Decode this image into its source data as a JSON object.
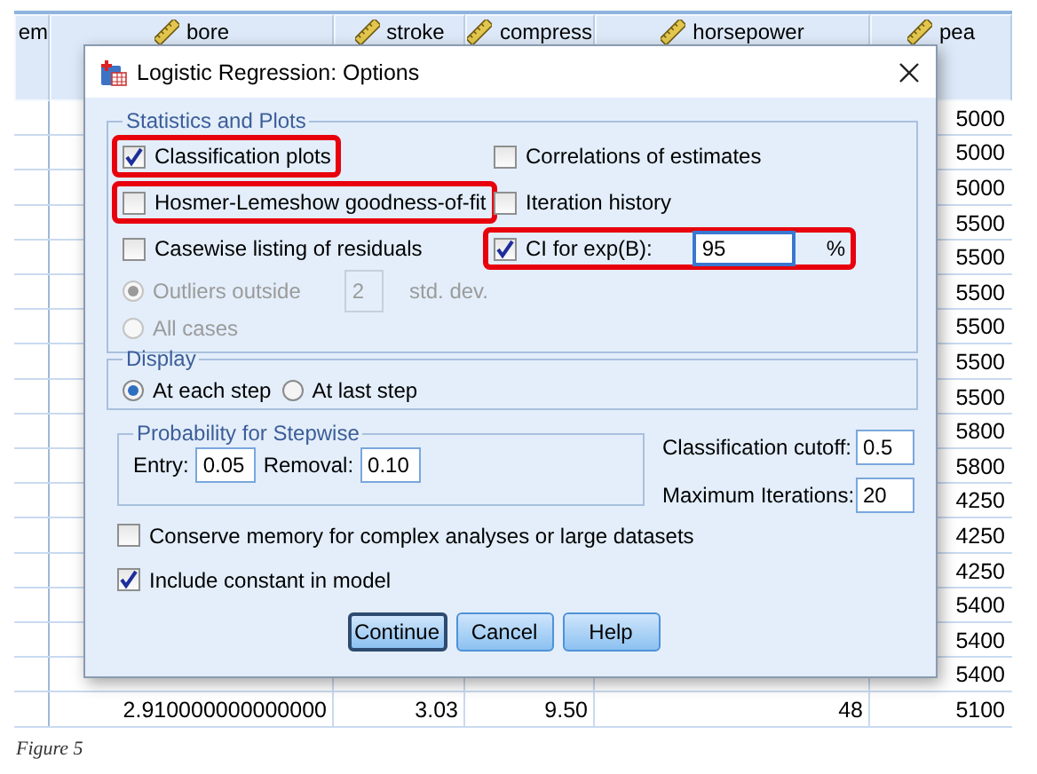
{
  "grid": {
    "columns": [
      {
        "label": "em"
      },
      {
        "label": "bore",
        "kind": "scale"
      },
      {
        "label": "stroke",
        "kind": "scale"
      },
      {
        "label": "compress",
        "kind": "scale"
      },
      {
        "label": "horsepower",
        "kind": "scale"
      },
      {
        "label": "pea",
        "kind": "scale"
      }
    ],
    "rows": [
      {
        "column_6": "5000"
      },
      {
        "column_6": "5000"
      },
      {
        "column_6": "5000"
      },
      {
        "column_6": "5500"
      },
      {
        "column_6": "5500"
      },
      {
        "column_6": "5500"
      },
      {
        "column_6": "5500"
      },
      {
        "column_6": "5500"
      },
      {
        "column_6": "5500"
      },
      {
        "column_6": "5800"
      },
      {
        "column_6": "5800"
      },
      {
        "column_6": "4250"
      },
      {
        "column_6": "4250"
      },
      {
        "column_6": "4250"
      },
      {
        "column_6": "5400"
      },
      {
        "column_6": "5400"
      },
      {
        "column_6": "5400"
      },
      {
        "column_2": "2.910000000000000",
        "column_3": "3.03",
        "column_4": "9.50",
        "column_5": "48",
        "column_6": "5100"
      }
    ]
  },
  "dialog": {
    "title": "Logistic Regression: Options",
    "statistics": {
      "title": "Statistics and Plots",
      "left": [
        {
          "label": "Classification plots",
          "checked": true,
          "highlighted": true
        },
        {
          "label": "Hosmer-Lemeshow goodness-of-fit",
          "checked": false,
          "highlighted": true
        },
        {
          "label": "Casewise listing of residuals",
          "checked": false,
          "highlighted": false
        }
      ],
      "residual_options": [
        {
          "label": "Outliers outside",
          "selected": true,
          "disabled": true,
          "value": "2",
          "unit": "std. dev."
        },
        {
          "label": "All cases",
          "selected": false,
          "disabled": true
        }
      ],
      "right": [
        {
          "label": "Correlations of estimates",
          "checked": false,
          "highlighted": false
        },
        {
          "label": "Iteration history",
          "checked": false,
          "highlighted": false
        },
        {
          "label": "CI for exp(B):",
          "checked": true,
          "highlighted": true,
          "value": "95",
          "unit": "%"
        }
      ]
    },
    "display": {
      "title": "Display",
      "options": [
        {
          "label": "At each step",
          "selected": true
        },
        {
          "label": "At last step",
          "selected": false
        }
      ]
    },
    "stepwise": {
      "title": "Probability for Stepwise",
      "fields": [
        {
          "label": "Entry:",
          "value": "0.05"
        },
        {
          "label": "Removal:",
          "value": "0.10"
        }
      ]
    },
    "criteria": [
      {
        "label": "Classification cutoff:",
        "value": "0.5"
      },
      {
        "label": "Maximum Iterations:",
        "value": "20"
      }
    ],
    "options": [
      {
        "label": "Conserve memory for complex analyses or large datasets",
        "checked": false
      },
      {
        "label": "Include constant in model",
        "checked": true
      }
    ],
    "buttons": [
      {
        "label": "Continue",
        "default": true
      },
      {
        "label": "Cancel",
        "default": false
      },
      {
        "label": "Help",
        "default": false
      }
    ]
  },
  "caption": "Figure 5"
}
